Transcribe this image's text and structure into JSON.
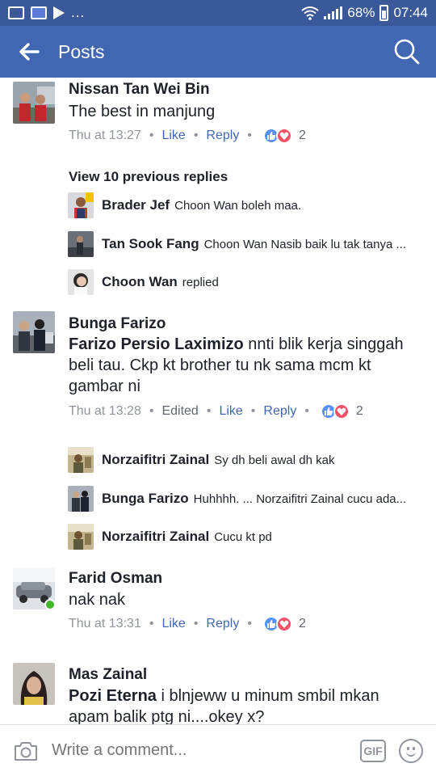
{
  "status_bar": {
    "battery": "68%",
    "time": "07:44",
    "dots": "..."
  },
  "app_bar": {
    "title": "Posts"
  },
  "comments": [
    {
      "name": "Nissan Tan Wei Bin",
      "text": "The best in manjung",
      "time": "Thu at 13:27",
      "like": "Like",
      "reply": "Reply",
      "reaction_count": "2",
      "view_more": "View 10 previous replies",
      "replies": [
        {
          "name": "Brader Jef",
          "text": "Choon Wan  boleh maa."
        },
        {
          "name": "Tan Sook Fang",
          "text": "Choon Wan Nasib baik lu tak tanya ..."
        },
        {
          "name": "Choon Wan",
          "text": "replied"
        }
      ]
    },
    {
      "name": "Bunga Farizo",
      "mention": "Farizo Persio Laximizo",
      "text_line1": "nnti blik kerja singgah",
      "text_line2": "beli tau. Ckp kt  brother tu nk sama mcm kt",
      "text_line3": "gambar ni",
      "time": "Thu at 13:28",
      "edited": "Edited",
      "like": "Like",
      "reply": "Reply",
      "reaction_count": "2",
      "replies": [
        {
          "name": "Norzaifitri Zainal",
          "text": "Sy dh beli awal dh kak"
        },
        {
          "name": "Bunga Farizo",
          "text": "Huhhhh. ... Norzaifitri Zainal cucu ada..."
        },
        {
          "name": "Norzaifitri Zainal",
          "text": "Cucu kt pd"
        }
      ]
    },
    {
      "name": "Farid Osman",
      "text": "nak nak",
      "time": "Thu at 13:31",
      "like": "Like",
      "reply": "Reply",
      "reaction_count": "2"
    },
    {
      "name": "Mas Zainal",
      "mention": "Pozi Eterna",
      "text_line1": "i blnjeww u minum smbil mkan",
      "text_line2": "apam balik ptg ni....okey x?"
    }
  ],
  "composer": {
    "placeholder": "Write a comment...",
    "gif_label": "GIF"
  },
  "colors": {
    "status_bar": "#3b5998",
    "app_bar": "#4267b2",
    "link": "#4267b2",
    "like_reaction": "#5890ff",
    "love_reaction": "#f25268",
    "online": "#42b72a"
  }
}
